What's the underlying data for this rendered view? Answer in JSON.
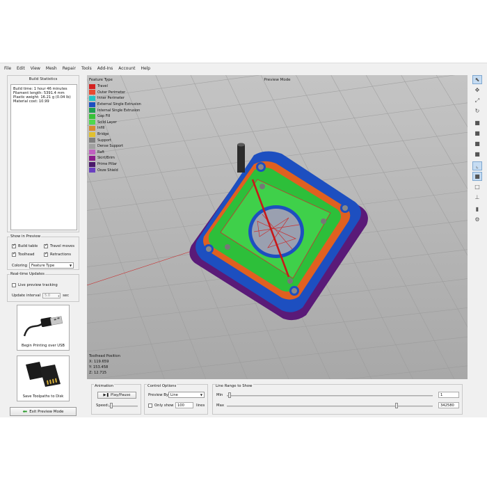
{
  "menu": [
    "File",
    "Edit",
    "View",
    "Mesh",
    "Repair",
    "Tools",
    "Add-Ins",
    "Account",
    "Help"
  ],
  "build_stats": {
    "title": "Build Statistics",
    "lines": [
      "Build time: 1 hour 46 minutes",
      "Filament length: 5391.4 mm",
      "Plastic weight: 16.21 g (0.04 lb)",
      "Material cost: 10.99"
    ]
  },
  "show_in_preview": {
    "title": "Show in Preview",
    "build_table": "Build table",
    "travel_moves": "Travel moves",
    "toolhead": "Toolhead",
    "retractions": "Retractions",
    "coloring_label": "Coloring",
    "coloring_value": "Feature Type"
  },
  "realtime": {
    "title": "Real-time Updates",
    "live_tracking": "Live preview tracking",
    "interval_label": "Update interval",
    "interval_value": "5.0",
    "interval_unit": "sec"
  },
  "usb_button": "Begin Printing over USB",
  "sd_button": "Save Toolpaths to Disk",
  "exit_button": "Exit Preview Mode",
  "viewport": {
    "title": "Preview Mode",
    "legend_title": "Feature Type",
    "legend": [
      {
        "label": "Travel",
        "color": "#d42020"
      },
      {
        "label": "Outer Perimeter",
        "color": "#e84a30"
      },
      {
        "label": "Inner Perimeter",
        "color": "#22c4c4"
      },
      {
        "label": "External Single Extrusion",
        "color": "#1d4fc0"
      },
      {
        "label": "Internal Single Extrusion",
        "color": "#1fa050"
      },
      {
        "label": "Gap Fill",
        "color": "#36c236"
      },
      {
        "label": "Solid Layer",
        "color": "#4fd84f"
      },
      {
        "label": "Infill",
        "color": "#d88a30"
      },
      {
        "label": "Bridge",
        "color": "#e0c030"
      },
      {
        "label": "Support",
        "color": "#808080"
      },
      {
        "label": "Dense Support",
        "color": "#a0a0a0"
      },
      {
        "label": "Raft",
        "color": "#c060c0"
      },
      {
        "label": "Skirt/Brim",
        "color": "#8a1a8a"
      },
      {
        "label": "Prime Pillar",
        "color": "#4a1a6a"
      },
      {
        "label": "Ooze Shield",
        "color": "#6a40c0"
      }
    ],
    "toolhead": {
      "title": "Toolhead Position",
      "x": "X: 119.659",
      "y": "Y: 153.458",
      "z": "Z: 12.715"
    }
  },
  "toolbar_icons": [
    "cursor-icon",
    "move-icon",
    "scale-icon",
    "rotate-icon",
    "view-iso-icon",
    "view-front-icon",
    "view-top-icon",
    "view-side-icon",
    "axis-icon",
    "view-perspective-icon",
    "wireframe-icon",
    "cross-section-icon",
    "material-icon",
    "settings-icon"
  ],
  "animation": {
    "title": "Animation",
    "play_label": "Play/Pause",
    "speed_label": "Speed:"
  },
  "control": {
    "title": "Control Options",
    "preview_by_label": "Preview By",
    "preview_by_value": "Line",
    "only_show_label": "Only show",
    "only_show_value": "100",
    "lines_unit": "lines"
  },
  "range": {
    "title": "Line Range to Show",
    "min_label": "Min",
    "max_label": "Max",
    "min_value": "1",
    "max_value": "342580"
  }
}
